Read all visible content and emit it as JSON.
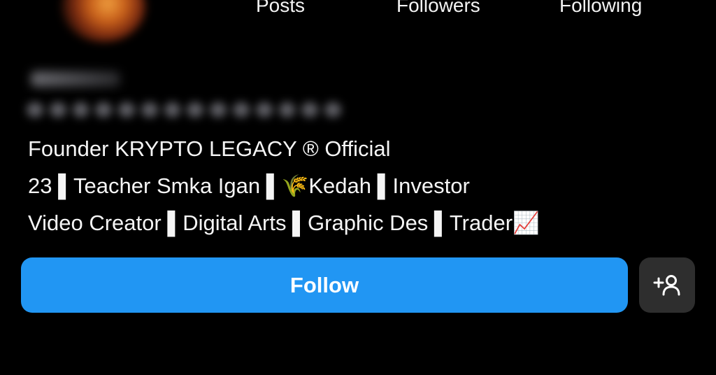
{
  "profile": {
    "stats": {
      "posts_label": "Posts",
      "followers_label": "Followers",
      "following_label": "Following"
    },
    "bio": {
      "line1": "Founder KRYPTO LEGACY ® Official",
      "line2": "23 ▌Teacher Smka Igan ▌🌾Kedah ▌Investor",
      "line3": "Video Creator ▌Digital Arts ▌Graphic Des ▌Trader📈"
    }
  },
  "actions": {
    "follow_label": "Follow",
    "add_friend_icon": "person-add-icon"
  },
  "colors": {
    "background": "#000000",
    "follow_button": "#2196f3",
    "secondary_button": "#2e2e2e",
    "text": "#ffffff"
  }
}
